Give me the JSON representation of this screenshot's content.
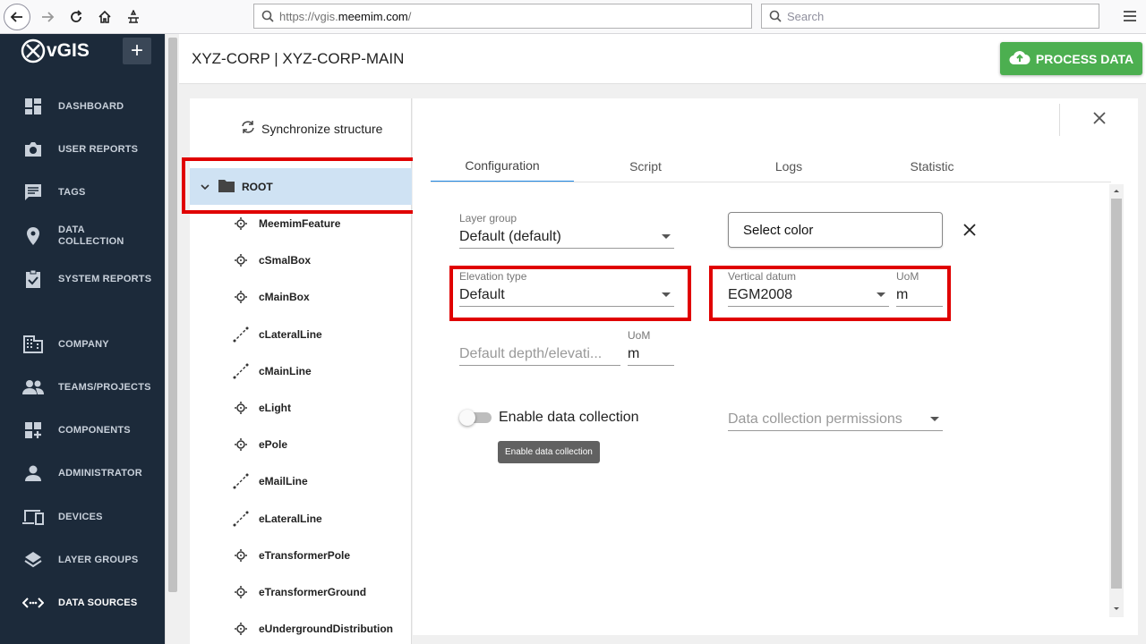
{
  "browser": {
    "url_prefix": "https://vgis.",
    "url_domain": "meemim.com",
    "url_suffix": "/",
    "search_placeholder": "Search"
  },
  "app": {
    "logo_text": "vGIS",
    "add_label": "+"
  },
  "sidebar": {
    "items": [
      {
        "label": "DASHBOARD",
        "icon": "dashboard-icon"
      },
      {
        "label": "USER REPORTS",
        "icon": "camera-icon"
      },
      {
        "label": "TAGS",
        "icon": "comment-icon"
      },
      {
        "label": "DATA",
        "label2": "COLLECTION",
        "icon": "location-pin-icon"
      },
      {
        "label": "SYSTEM REPORTS",
        "icon": "clipboard-check-icon"
      },
      {
        "label": "COMPANY",
        "icon": "building-icon"
      },
      {
        "label": "TEAMS/PROJECTS",
        "icon": "people-icon"
      },
      {
        "label": "COMPONENTS",
        "icon": "components-icon"
      },
      {
        "label": "ADMINISTRATOR",
        "icon": "person-icon"
      },
      {
        "label": "DEVICES",
        "icon": "devices-icon"
      },
      {
        "label": "LAYER GROUPS",
        "icon": "layers-icon"
      },
      {
        "label": "DATA SOURCES",
        "icon": "code-arrows-icon"
      }
    ]
  },
  "header": {
    "title": "XYZ-CORP | XYZ-CORP-MAIN",
    "process_label": "PROCESS DATA"
  },
  "tree": {
    "sync_label": "Synchronize structure",
    "root_label": "ROOT",
    "items": [
      {
        "label": "MeemimFeature",
        "icon": "point-feature-icon"
      },
      {
        "label": "cSmalBox",
        "icon": "point-feature-icon"
      },
      {
        "label": "cMainBox",
        "icon": "point-feature-icon"
      },
      {
        "label": "cLateralLine",
        "icon": "line-feature-icon"
      },
      {
        "label": "cMainLine",
        "icon": "line-feature-icon"
      },
      {
        "label": "eLight",
        "icon": "point-feature-icon"
      },
      {
        "label": "ePole",
        "icon": "point-feature-icon"
      },
      {
        "label": "eMailLine",
        "icon": "line-feature-icon"
      },
      {
        "label": "eLateralLine",
        "icon": "line-feature-icon"
      },
      {
        "label": "eTransformerPole",
        "icon": "point-feature-icon"
      },
      {
        "label": "eTransformerGround",
        "icon": "point-feature-icon"
      },
      {
        "label": "eUndergroundDistribution",
        "icon": "point-feature-icon"
      }
    ]
  },
  "tabs": [
    {
      "label": "Configuration"
    },
    {
      "label": "Script"
    },
    {
      "label": "Logs"
    },
    {
      "label": "Statistic"
    }
  ],
  "config": {
    "layer_group": {
      "label": "Layer group",
      "value": "Default (default)"
    },
    "select_color_label": "Select color",
    "elevation_type": {
      "label": "Elevation type",
      "value": "Default"
    },
    "vertical_datum": {
      "label": "Vertical datum",
      "value": "EGM2008"
    },
    "uom1": {
      "label": "UoM",
      "value": "m"
    },
    "default_depth": {
      "placeholder": "Default depth/elevati..."
    },
    "uom2": {
      "label": "UoM",
      "value": "m"
    },
    "enable_data_collection": "Enable data collection",
    "data_collection_permissions": "Data collection permissions",
    "tooltip": "Enable data collection"
  }
}
